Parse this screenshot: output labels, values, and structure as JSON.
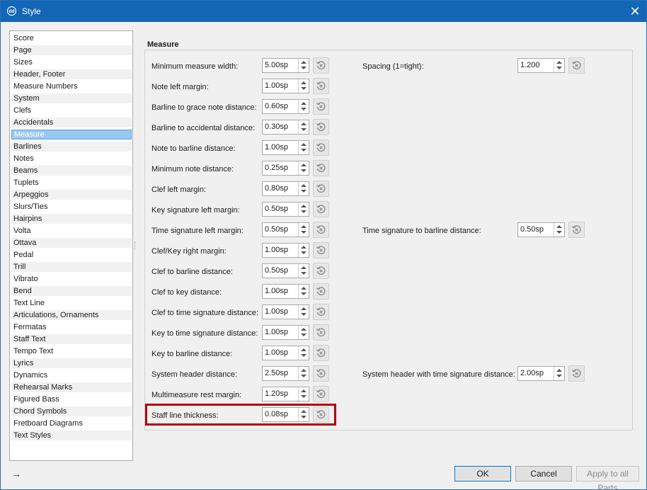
{
  "window": {
    "title": "Style",
    "close_icon": "close-icon"
  },
  "sidebar": {
    "items": [
      "Score",
      "Page",
      "Sizes",
      "Header, Footer",
      "Measure Numbers",
      "System",
      "Clefs",
      "Accidentals",
      "Measure",
      "Barlines",
      "Notes",
      "Beams",
      "Tuplets",
      "Arpeggios",
      "Slurs/Ties",
      "Hairpins",
      "Volta",
      "Ottava",
      "Pedal",
      "Trill",
      "Vibrato",
      "Bend",
      "Text Line",
      "Articulations, Ornaments",
      "Fermatas",
      "Staff Text",
      "Tempo Text",
      "Lyrics",
      "Dynamics",
      "Rehearsal Marks",
      "Figured Bass",
      "Chord Symbols",
      "Fretboard Diagrams",
      "Text Styles"
    ],
    "selected": "Measure"
  },
  "section": {
    "title": "Measure"
  },
  "left_fields": [
    {
      "label": "Minimum measure width:",
      "value": "5.00sp"
    },
    {
      "label": "Note left margin:",
      "value": "1.00sp"
    },
    {
      "label": "Barline to grace note distance:",
      "value": "0.60sp"
    },
    {
      "label": "Barline to accidental distance:",
      "value": "0.30sp"
    },
    {
      "label": "Note to barline distance:",
      "value": "1.00sp"
    },
    {
      "label": "Minimum note distance:",
      "value": "0.25sp"
    },
    {
      "label": "Clef left margin:",
      "value": "0.80sp"
    },
    {
      "label": "Key signature left margin:",
      "value": "0.50sp"
    },
    {
      "label": "Time signature left margin:",
      "value": "0.50sp"
    },
    {
      "label": "Clef/Key right margin:",
      "value": "1.00sp"
    },
    {
      "label": "Clef to barline distance:",
      "value": "0.50sp"
    },
    {
      "label": "Clef to key distance:",
      "value": "1.00sp"
    },
    {
      "label": "Clef to time signature distance:",
      "value": "1.00sp"
    },
    {
      "label": "Key to time signature distance:",
      "value": "1.00sp"
    },
    {
      "label": "Key to barline distance:",
      "value": "1.00sp"
    },
    {
      "label": "System header distance:",
      "value": "2.50sp"
    },
    {
      "label": "Multimeasure rest margin:",
      "value": "1.20sp"
    },
    {
      "label": "Staff line thickness:",
      "value": "0.08sp"
    }
  ],
  "right_fields": [
    {
      "label": "Spacing (1=tight):",
      "value": "1.200"
    },
    {
      "label": "Time signature to barline distance:",
      "value": "0.50sp"
    },
    {
      "label": "System header with time signature distance:",
      "value": "2.00sp"
    }
  ],
  "buttons": {
    "ok": "OK",
    "cancel": "Cancel",
    "apply_all": "Apply to all Parts"
  },
  "colors": {
    "titlebar": "#1466b6",
    "selection": "#99c9ef",
    "highlight": "#b30000"
  }
}
